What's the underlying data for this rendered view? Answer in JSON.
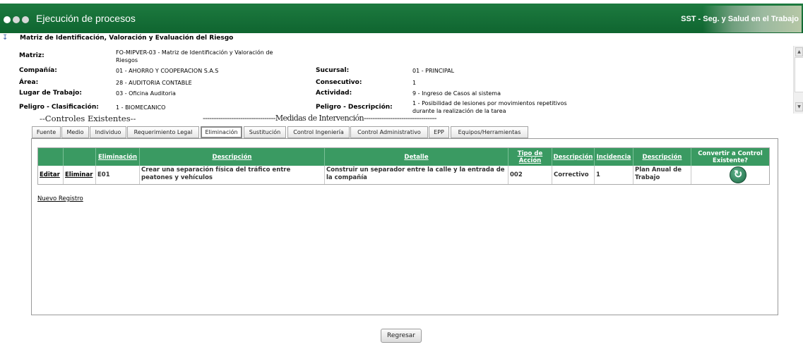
{
  "header": {
    "title": "Ejecución de procesos",
    "right_text": "SST - Seg. y Salud en el Trabajo",
    "bg_color": "#1d7a3f"
  },
  "section": {
    "title": "Matriz de Identificación, Valoración y Evaluación del Riesgo"
  },
  "info": {
    "matriz_label": "Matriz:",
    "matriz_value_line1": "FO-MIPVER-03 - Matriz de Identificación y Valoración de",
    "matriz_value_line2": "Riesgos",
    "compania_label": "Compañía:",
    "compania_value": "01 - AHORRO Y COOPERACION S.A.S",
    "sucursal_label": "Sucursal:",
    "sucursal_value": "01 - PRINCIPAL",
    "area_label": "Área:",
    "area_value": "28 - AUDITORIA CONTABLE",
    "consecutivo_label": "Consecutivo:",
    "consecutivo_value": "1",
    "lugar_label": "Lugar de Trabajo:",
    "lugar_value": "03 - Oficina Auditoria",
    "actividad_label": "Actividad:",
    "actividad_value": "9 - Ingreso de Casos al sistema",
    "peligro_clas_label": "Peligro - Clasificación:",
    "peligro_clas_value": "1 - BIOMECANICO",
    "peligro_desc_label": "Peligro - Descripción:",
    "peligro_desc_line1": "1 - Posibilidad de lesiones por movimientos repetitivos",
    "peligro_desc_line2": "durante la realización de la tarea"
  },
  "groups": {
    "controles": "--Controles Existentes--",
    "medidas": "---------------------------------Medidas de Intervención---------------------------------"
  },
  "tabs": [
    {
      "label": "Fuente"
    },
    {
      "label": "Medio"
    },
    {
      "label": "Individuo"
    },
    {
      "label": "Requerimiento Legal"
    },
    {
      "label": "Eliminación",
      "active": true
    },
    {
      "label": "Sustitución"
    },
    {
      "label": "Control Ingeniería"
    },
    {
      "label": "Control Administrativo"
    },
    {
      "label": "EPP"
    },
    {
      "label": "Equipos/Herramientas"
    }
  ],
  "grid": {
    "header_color": "#3a9a62",
    "columns": {
      "eliminacion": "Eliminación",
      "descripcion": "Descripción",
      "detalle": "Detalle",
      "tipo_accion_line1": "Tipo de",
      "tipo_accion_line2": "Acción",
      "descripcion2": "Descripción",
      "incidencia": "Incidencia",
      "descripcion3": "Descripción",
      "convertir_line1": "Convertir a Control",
      "convertir_line2": "Existente?"
    },
    "rows": [
      {
        "editar": "Editar",
        "eliminar": "Eliminar",
        "codigo": "E01",
        "descripcion": "Crear una separación física del tráfico entre peatones y vehículos",
        "detalle": "Construir un separador entre la calle y la entrada de la compañía",
        "tipo_accion": "002",
        "tipo_desc": "Correctivo",
        "incidencia": "1",
        "incidencia_desc": "Plan Anual de Trabajo",
        "convert_icon": "refresh-icon"
      }
    ]
  },
  "nuevo_registro": "Nuevo Registro",
  "regresar": "Regresar"
}
